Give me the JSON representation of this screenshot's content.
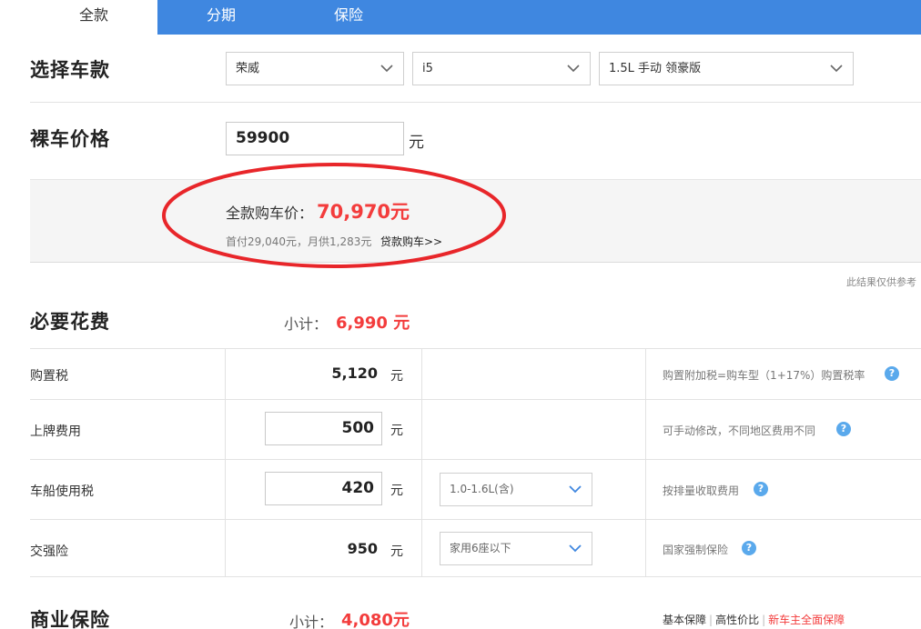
{
  "tabs": [
    {
      "label": "全款"
    },
    {
      "label": "分期"
    },
    {
      "label": "保险"
    }
  ],
  "select_car": {
    "title": "选择车款",
    "brand": "荣威",
    "model": "i5",
    "version": "1.5L 手动 领豪版"
  },
  "bare_price": {
    "title": "裸车价格",
    "value": "59900",
    "unit": "元"
  },
  "result": {
    "total_label": "全款购车价：",
    "total_value": "70,970元",
    "subline": "首付29,040元，月供1,283元",
    "loan_link": "贷款购车>>",
    "note": "此结果仅供参考"
  },
  "colors": {
    "accent": "#3f87e0",
    "highlight": "#f33c3c",
    "circle": "#e8262a"
  },
  "necessary": {
    "title": "必要花费",
    "subtotal_label": "小计：",
    "subtotal_value": "6,990 元",
    "rows": [
      {
        "label": "购置税",
        "amount": "5,120",
        "unit": "元",
        "desc": "购置附加税=购车型（1+17%）购置税率"
      },
      {
        "label": "上牌费用",
        "amount": "500",
        "unit": "元",
        "desc": "可手动修改，不同地区费用不同"
      },
      {
        "label": "车船使用税",
        "amount": "420",
        "unit": "元",
        "option": "1.0-1.6L(含)",
        "desc": "按排量收取费用"
      },
      {
        "label": "交强险",
        "amount": "950",
        "unit": "元",
        "option": "家用6座以下",
        "desc": "国家强制保险"
      }
    ],
    "help_glyph": "?"
  },
  "commercial": {
    "title": "商业保险",
    "subtotal_label": "小计：",
    "subtotal_value": "4,080元",
    "links": [
      "基本保障",
      "高性价比",
      "新车主全面保障"
    ]
  }
}
